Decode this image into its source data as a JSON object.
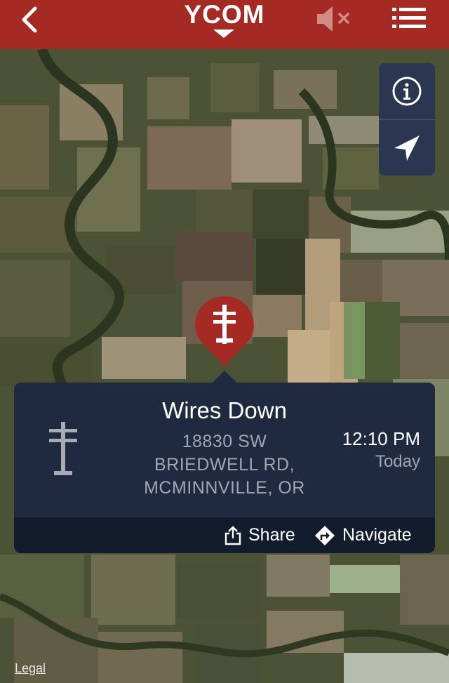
{
  "header": {
    "title": "YCOM",
    "back_icon": "chevron-left-icon",
    "mute_icon": "speaker-muted-icon",
    "menu_icon": "list-menu-icon",
    "background_color": "#a52a24"
  },
  "map_controls": {
    "info_icon": "info-icon",
    "location_icon": "location-arrow-icon"
  },
  "marker": {
    "icon": "utility-pole-icon",
    "color": "#a52a24"
  },
  "callout": {
    "title": "Wires Down",
    "address_line1": "18830 SW",
    "address_line2": "BRIEDWELL RD,",
    "address_line3": "MCMINNVILLE, OR",
    "time": "12:10 PM",
    "day": "Today",
    "share_label": "Share",
    "navigate_label": "Navigate"
  },
  "map": {
    "legal_label": "Legal"
  }
}
